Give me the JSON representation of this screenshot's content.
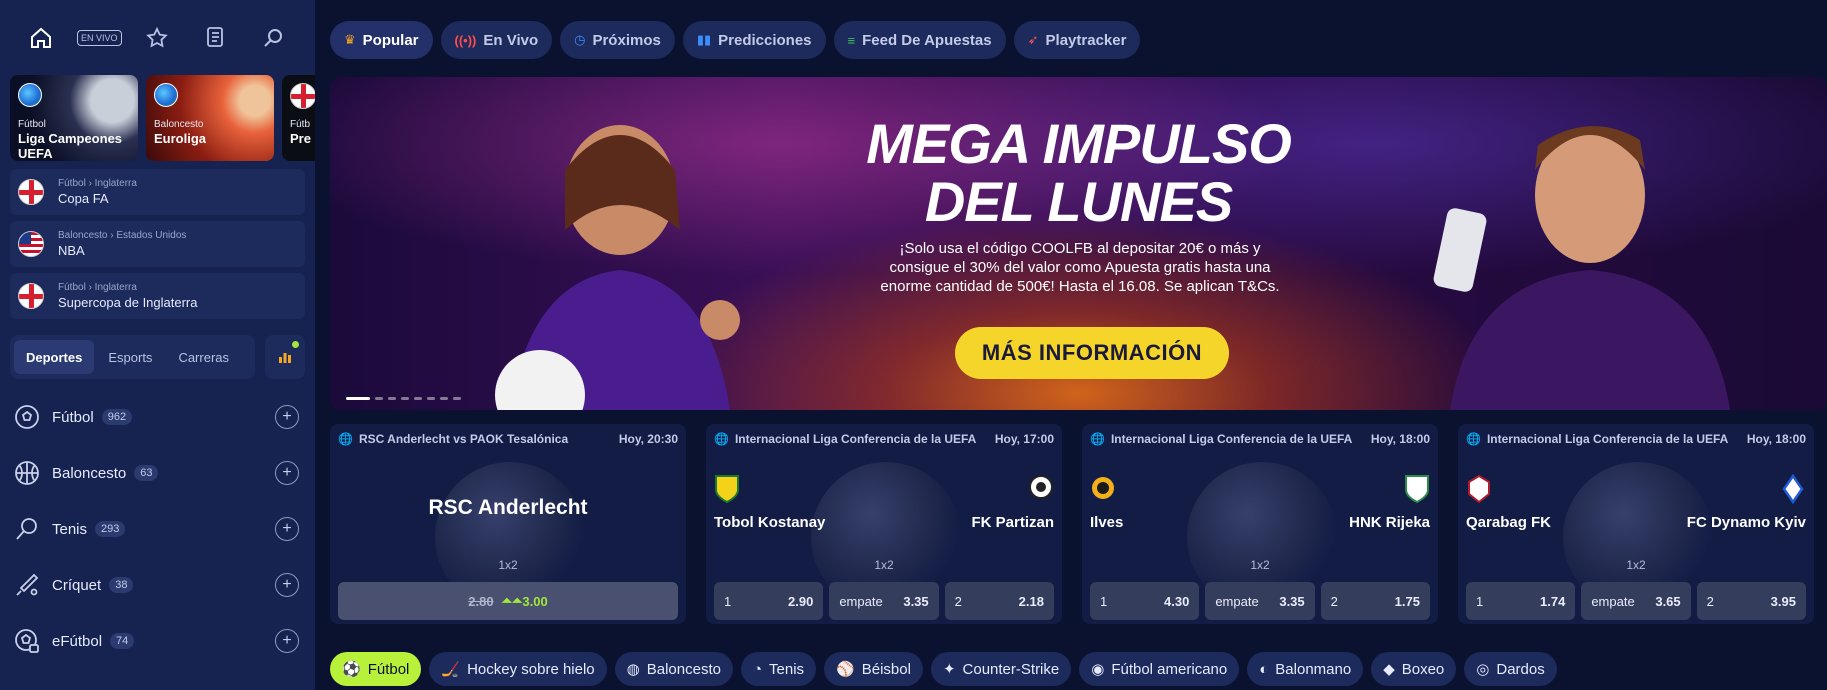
{
  "sidebar": {
    "top_icons": [
      {
        "icon": "home-icon"
      },
      {
        "icon": "live-icon",
        "label": "EN VIVO"
      },
      {
        "icon": "star-icon"
      },
      {
        "icon": "betslip-icon"
      },
      {
        "icon": "search-icon"
      }
    ],
    "featured": [
      {
        "sport": "Fútbol",
        "title": "Liga Campeones UEFA"
      },
      {
        "sport": "Baloncesto",
        "title": "Euroliga"
      },
      {
        "sport": "Fútb",
        "title": "Pre"
      }
    ],
    "leagues": [
      {
        "crumb": "Fútbol › Inglaterra",
        "name": "Copa FA",
        "flag": "england"
      },
      {
        "crumb": "Baloncesto › Estados Unidos",
        "name": "NBA",
        "flag": "usa"
      },
      {
        "crumb": "Fútbol › Inglaterra",
        "name": "Supercopa de Inglaterra",
        "flag": "england"
      }
    ],
    "segments": [
      "Deportes",
      "Esports",
      "Carreras"
    ],
    "sports": [
      {
        "name": "Fútbol",
        "count": "962",
        "icon": "soccer-ball-icon"
      },
      {
        "name": "Baloncesto",
        "count": "63",
        "icon": "basketball-icon"
      },
      {
        "name": "Tenis",
        "count": "293",
        "icon": "tennis-icon"
      },
      {
        "name": "Críquet",
        "count": "38",
        "icon": "cricket-icon"
      },
      {
        "name": "eFútbol",
        "count": "74",
        "icon": "efootball-icon"
      }
    ]
  },
  "tabs": [
    {
      "label": "Popular",
      "icon": "crown-icon",
      "color": "#f5a623"
    },
    {
      "label": "En Vivo",
      "icon": "broadcast-icon",
      "color": "#ff4d4d"
    },
    {
      "label": "Próximos",
      "icon": "clock-icon",
      "color": "#3f8cff"
    },
    {
      "label": "Predicciones",
      "icon": "bars-icon",
      "color": "#3f8cff"
    },
    {
      "label": "Feed De Apuestas",
      "icon": "feed-icon",
      "color": "#3fbf5f"
    },
    {
      "label": "Playtracker",
      "icon": "rocket-icon",
      "color": "#ff5a5a"
    }
  ],
  "banner": {
    "headline_1": "MEGA IMPULSO",
    "headline_2": "DEL LUNES",
    "promo_1": "¡Solo usa el código COOLFB al depositar 20€ o más y",
    "promo_2": "consigue el 30% del valor como Apuesta gratis hasta una",
    "promo_3": "enorme cantidad de 500€! Hasta el 16.08. Se aplican T&Cs.",
    "cta": "MÁS INFORMACIÓN"
  },
  "matches": [
    {
      "competition": "RSC Anderlecht vs PAOK Tesalónica",
      "time": "Hoy, 20:30",
      "team": "RSC Anderlecht",
      "market": "1x2",
      "odd_old": "2.80",
      "odd_new": "3.00"
    },
    {
      "competition": "Internacional Liga Conferencia de la UEFA",
      "time": "Hoy, 17:00",
      "home": "Tobol Kostanay",
      "away": "FK Partizan",
      "market": "1x2",
      "o1_label": "1",
      "o1": "2.90",
      "ox_label": "empate",
      "ox": "3.35",
      "o2_label": "2",
      "o2": "2.18"
    },
    {
      "competition": "Internacional Liga Conferencia de la UEFA",
      "time": "Hoy, 18:00",
      "home": "Ilves",
      "away": "HNK Rijeka",
      "market": "1x2",
      "o1_label": "1",
      "o1": "4.30",
      "ox_label": "empate",
      "ox": "3.35",
      "o2_label": "2",
      "o2": "1.75"
    },
    {
      "competition": "Internacional Liga Conferencia de la UEFA",
      "time": "Hoy, 18:00",
      "home": "Qarabag FK",
      "away": "FC Dynamo Kyiv",
      "market": "1x2",
      "o1_label": "1",
      "o1": "1.74",
      "ox_label": "empate",
      "ox": "3.65",
      "o2_label": "2",
      "o2": "3.95"
    }
  ],
  "sport_pills": [
    {
      "label": "Fútbol",
      "icon": "soccer-ball-icon"
    },
    {
      "label": "Hockey sobre hielo",
      "icon": "hockey-icon"
    },
    {
      "label": "Baloncesto",
      "icon": "basketball-icon"
    },
    {
      "label": "Tenis",
      "icon": "tennis-icon"
    },
    {
      "label": "Béisbol",
      "icon": "baseball-icon"
    },
    {
      "label": "Counter-Strike",
      "icon": "counter-strike-icon"
    },
    {
      "label": "Fútbol americano",
      "icon": "american-football-icon"
    },
    {
      "label": "Balonmano",
      "icon": "handball-icon"
    },
    {
      "label": "Boxeo",
      "icon": "boxing-icon"
    },
    {
      "label": "Dardos",
      "icon": "darts-icon"
    }
  ],
  "colors": {
    "accent": "#b8f13a",
    "cta": "#f6d52a",
    "sidebar": "#16224f",
    "background": "#0b1230"
  }
}
